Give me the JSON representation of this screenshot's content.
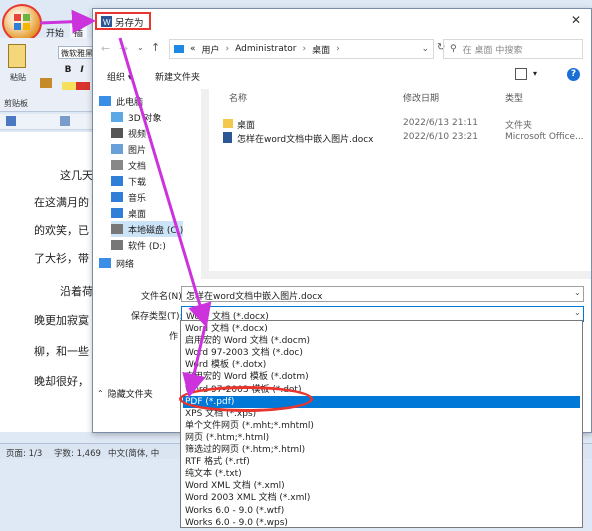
{
  "word": {
    "tabs": [
      "开始",
      "插"
    ],
    "ribbon": {
      "font_name": "微软雅黑",
      "paste_label": "粘贴",
      "group_label": "剪贴板"
    },
    "doc_lines": [
      "这几天",
      "在这满月的",
      "的欢笑，已",
      "了大衫，带",
      "沿着荷",
      "晚更加寂寞",
      "柳，和一些",
      "晚却很好，"
    ],
    "status": {
      "page": "页面: 1/3",
      "words": "字数: 1,469",
      "lang": "中文(简体, 中"
    }
  },
  "dialog": {
    "title": "另存为",
    "address": {
      "prefix": "«",
      "parts": [
        "用户",
        "Administrator",
        "桌面"
      ]
    },
    "search_placeholder": "在 桌面 中搜索",
    "cmdbar": {
      "organize": "组织 ▾",
      "new_folder": "新建文件夹"
    },
    "nav": [
      {
        "label": "此电脑",
        "icon": "computer-icon"
      },
      {
        "label": "3D 对象",
        "icon": "cube-icon"
      },
      {
        "label": "视频",
        "icon": "video-icon"
      },
      {
        "label": "图片",
        "icon": "picture-icon"
      },
      {
        "label": "文档",
        "icon": "document-icon"
      },
      {
        "label": "下载",
        "icon": "download-icon"
      },
      {
        "label": "音乐",
        "icon": "music-icon"
      },
      {
        "label": "桌面",
        "icon": "desktop-icon"
      },
      {
        "label": "本地磁盘 (C:)",
        "icon": "disk-icon"
      },
      {
        "label": "软件 (D:)",
        "icon": "disk-icon"
      },
      {
        "label": "网络",
        "icon": "network-icon"
      }
    ],
    "columns": {
      "name": "名称",
      "modified": "修改日期",
      "type": "类型"
    },
    "files": [
      {
        "name": "桌面",
        "modified": "2022/6/13 21:11",
        "type": "文件夹",
        "icon": "folder-icon"
      },
      {
        "name": "怎样在word文档中嵌入图片.docx",
        "modified": "2022/6/10 23:21",
        "type": "Microsoft Office...",
        "icon": "word-doc-icon"
      }
    ],
    "filename_label": "文件名(N):",
    "filename_value": "怎样在word文档中嵌入图片.docx",
    "savetype_label": "保存类型(T):",
    "savetype_value": "Word 文档 (*.docx)",
    "author_label": "作",
    "hide_folders": "隐藏文件夹",
    "type_options": [
      "Word 文档 (*.docx)",
      "启用宏的 Word 文档 (*.docm)",
      "Word 97-2003 文档 (*.doc)",
      "Word 模板 (*.dotx)",
      "启用宏的 Word 模板 (*.dotm)",
      "Word 97-2003 模板 (*.dot)",
      "PDF (*.pdf)",
      "XPS 文档 (*.xps)",
      "单个文件网页 (*.mht;*.mhtml)",
      "网页 (*.htm;*.html)",
      "筛选过的网页 (*.htm;*.html)",
      "RTF 格式 (*.rtf)",
      "纯文本 (*.txt)",
      "Word XML 文档 (*.xml)",
      "Word 2003 XML 文档 (*.xml)",
      "Works 6.0 - 9.0 (*.wtf)",
      "Works 6.0 - 9.0 (*.wps)"
    ],
    "selected_option": "PDF (*.pdf)"
  },
  "colors": {
    "highlight": "#e8352d",
    "arrow": "#cc33dd",
    "selection": "#0078d7"
  }
}
